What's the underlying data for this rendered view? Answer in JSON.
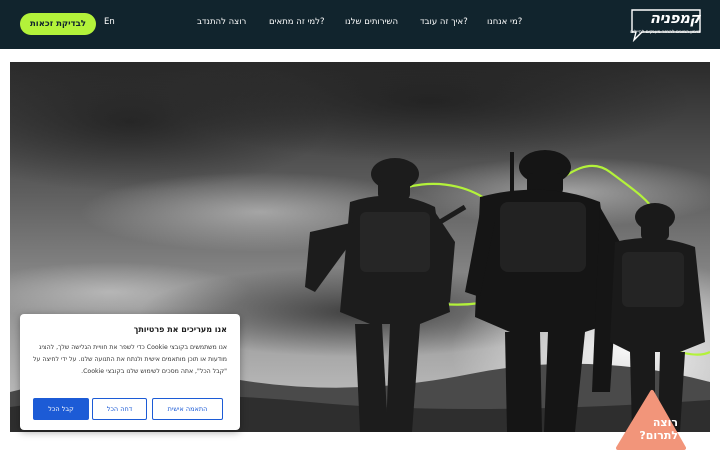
{
  "header": {
    "eligibility_button": "לבדיקת זכאות",
    "language": "En",
    "nav": [
      {
        "label": "מי אנחנו?"
      },
      {
        "label": "איך זה עובד?"
      },
      {
        "label": "השירותים שלנו"
      },
      {
        "label": "למי זה מתאים?"
      },
      {
        "label": "רוצה להתנדב"
      }
    ],
    "logo": {
      "name": "קמפניה",
      "tagline": "מימון המונים להחזר מענקים לחיילים"
    }
  },
  "hero": {
    "image": "soldiers-silhouette-sky",
    "accent_line_color": "#b3f23a"
  },
  "cookie": {
    "title": "אנו מעריכים את פרטיותך",
    "body": "אנו משתמשים בקובצי Cookie כדי לשפר את חוויית הגלישה שלך, להציג מודעות או תוכן מותאמים אישית ולנתח את התנועה שלנו. על ידי לחיצה על \"קבל הכל\", אתה מסכים לשימוש שלנו בקובצי Cookie.",
    "customize": "התאמה אישית",
    "reject": "דחה הכל",
    "accept": "קבל הכל"
  },
  "donate": {
    "line1": "רוצה",
    "line2": "לתרום?",
    "color": "#f2957a"
  },
  "colors": {
    "header_bg": "#11242d",
    "accent_green": "#b3f23a",
    "primary_blue": "#1c5bd6"
  }
}
